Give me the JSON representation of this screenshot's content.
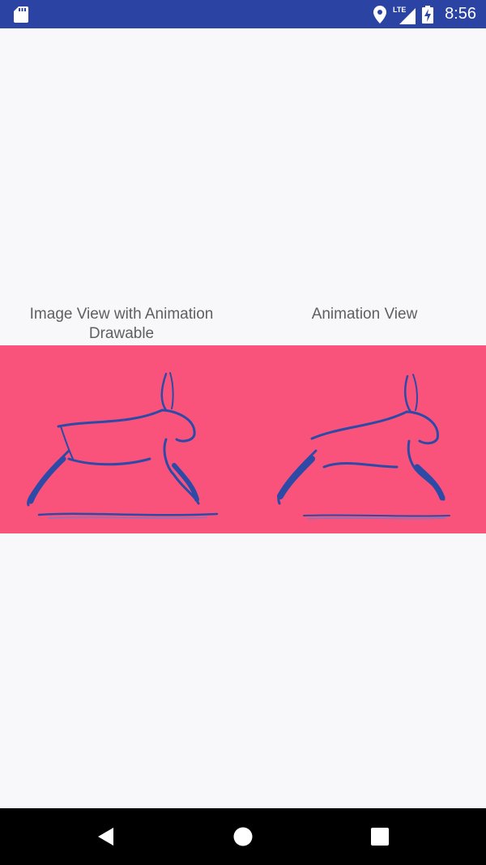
{
  "status_bar": {
    "time": "8:56",
    "network_label": "LTE",
    "icons": [
      "sd-card-icon",
      "location-icon",
      "lte-signal-icon",
      "battery-charging-icon"
    ],
    "background_color": "#2b43a3"
  },
  "labels": {
    "left": "Image View with Animation Drawable",
    "right": "Animation View"
  },
  "animation_panel": {
    "background_color": "#fa537b",
    "image_subject": "running rabbit sketch"
  },
  "nav_bar": {
    "buttons": [
      "back-icon",
      "home-icon",
      "recent-apps-icon"
    ]
  }
}
